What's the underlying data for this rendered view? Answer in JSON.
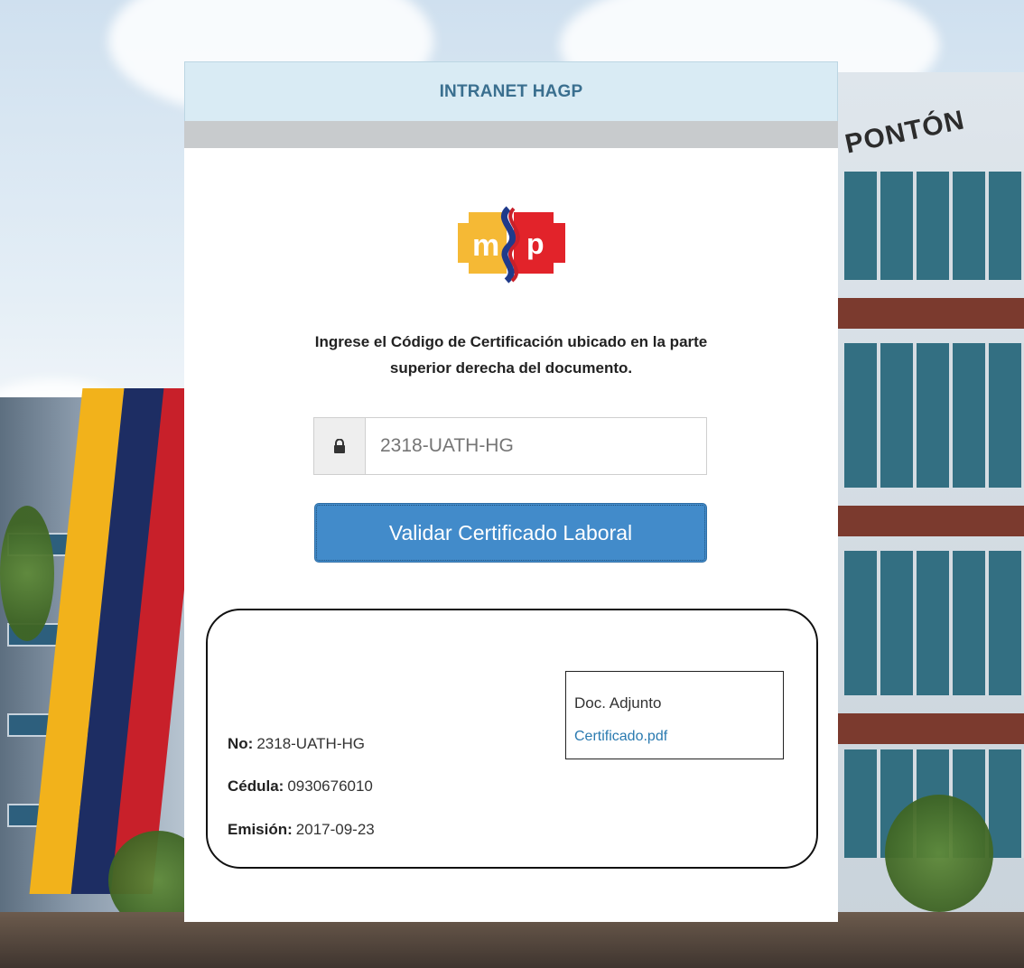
{
  "header": {
    "title": "INTRANET HAGP"
  },
  "background": {
    "building_sign": "PONTÓN"
  },
  "logo": {
    "left_letter": "m",
    "right_letter": "p",
    "colors": {
      "yellow": "#f5b935",
      "blue": "#1f3a8a",
      "red": "#e2232a"
    }
  },
  "instructions": {
    "text": "Ingrese el Código de Certificación ubicado en la parte superior derecha del documento."
  },
  "code_input": {
    "value": "",
    "placeholder": "2318-UATH-HG",
    "icon": "lock-icon"
  },
  "validate_button": {
    "label": "Validar Certificado Laboral",
    "color": "#428bca"
  },
  "result": {
    "no_label": "No:",
    "no_value": "2318-UATH-HG",
    "cedula_label": "Cédula:",
    "cedula_value": "0930676010",
    "emision_label": "Emisión:",
    "emision_value": "2017-09-23",
    "attachment_label": "Doc. Adjunto",
    "attachment_link": "Certificado.pdf"
  }
}
